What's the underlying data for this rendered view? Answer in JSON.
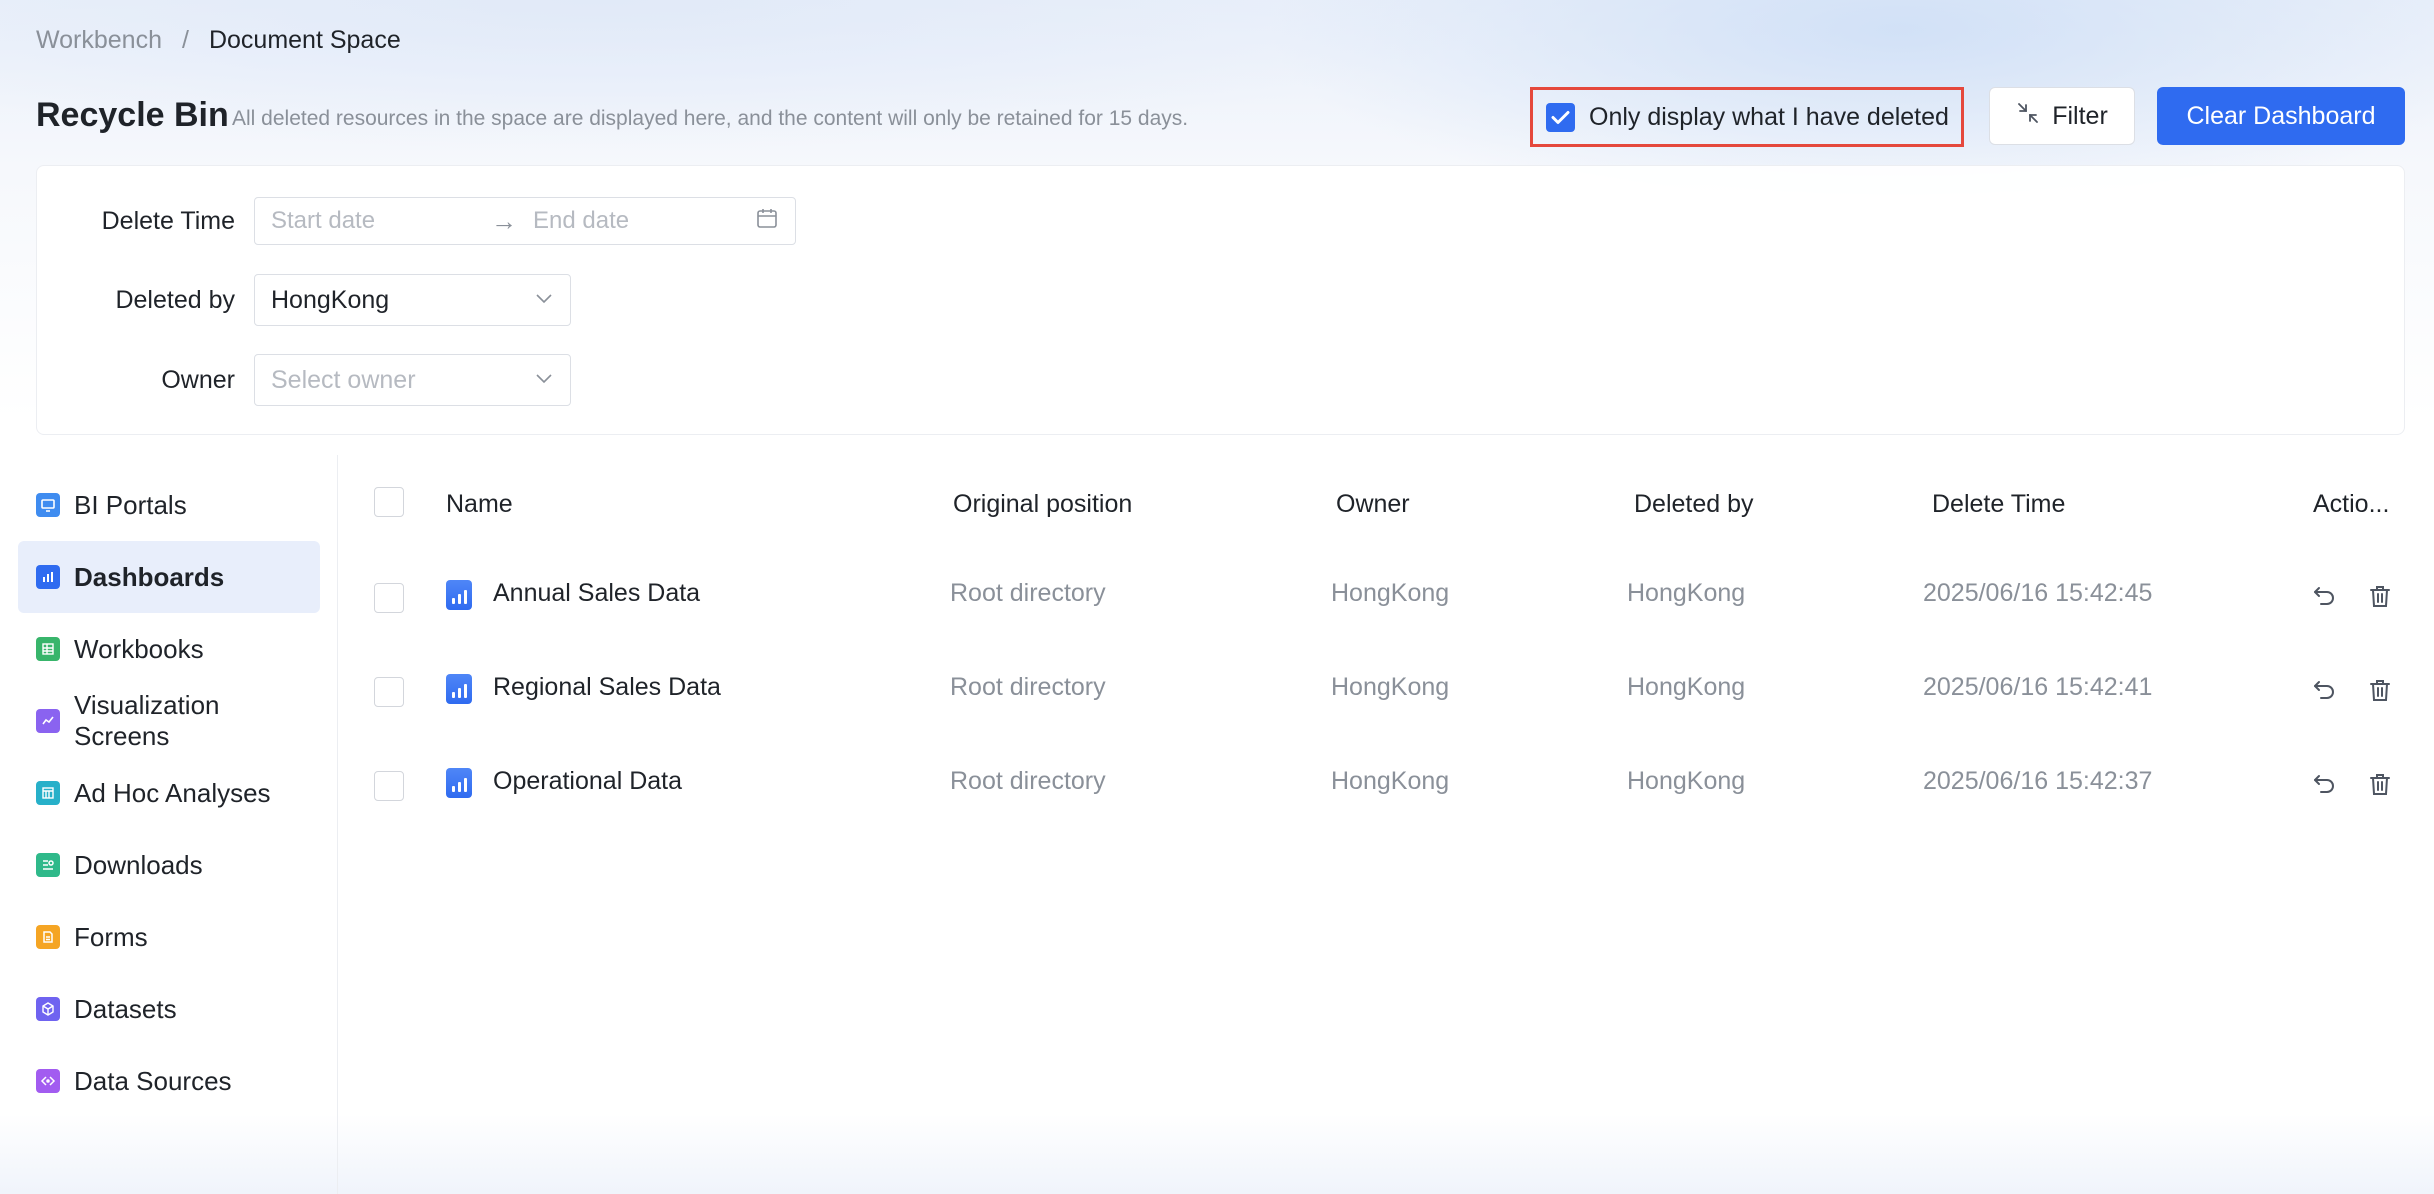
{
  "breadcrumb": {
    "root": "Workbench",
    "separator": "/",
    "current": "Document Space"
  },
  "header": {
    "title": "Recycle Bin",
    "description": "All deleted resources in the space are displayed here, and the content will only be retained for 15 days.",
    "only_mine_label": "Only display what I have deleted",
    "only_mine_checked": true,
    "filter_label": "Filter",
    "clear_label": "Clear Dashboard"
  },
  "filters": {
    "delete_time": {
      "label": "Delete Time",
      "start_placeholder": "Start date",
      "arrow": "→",
      "end_placeholder": "End date"
    },
    "deleted_by": {
      "label": "Deleted by",
      "value": "HongKong"
    },
    "owner": {
      "label": "Owner",
      "placeholder": "Select owner"
    }
  },
  "sidebar": {
    "items": [
      {
        "label": "BI Portals",
        "icon": "monitor-icon",
        "color": "#3f8cf0",
        "active": false
      },
      {
        "label": "Dashboards",
        "icon": "bar-chart-icon",
        "color": "#2f6bf0",
        "active": true
      },
      {
        "label": "Workbooks",
        "icon": "table-icon",
        "color": "#38b56b",
        "active": false
      },
      {
        "label": "Visualization Screens",
        "icon": "line-chart-icon",
        "color": "#8a63f0",
        "active": false
      },
      {
        "label": "Ad Hoc Analyses",
        "icon": "grid-icon",
        "color": "#27b0c9",
        "active": false
      },
      {
        "label": "Downloads",
        "icon": "download-list-icon",
        "color": "#2fb98a",
        "active": false
      },
      {
        "label": "Forms",
        "icon": "form-icon",
        "color": "#f5a524",
        "active": false
      },
      {
        "label": "Datasets",
        "icon": "cube-icon",
        "color": "#6f63f0",
        "active": false
      },
      {
        "label": "Data Sources",
        "icon": "data-source-icon",
        "color": "#a25cf0",
        "active": false
      }
    ]
  },
  "table": {
    "columns": [
      "Name",
      "Original position",
      "Owner",
      "Deleted by",
      "Delete Time",
      "Actio..."
    ],
    "rows": [
      {
        "name": "Annual Sales Data",
        "position": "Root directory",
        "owner": "HongKong",
        "deleted_by": "HongKong",
        "delete_time": "2025/06/16 15:42:45"
      },
      {
        "name": "Regional Sales Data",
        "position": "Root directory",
        "owner": "HongKong",
        "deleted_by": "HongKong",
        "delete_time": "2025/06/16 15:42:41"
      },
      {
        "name": "Operational Data",
        "position": "Root directory",
        "owner": "HongKong",
        "deleted_by": "HongKong",
        "delete_time": "2025/06/16 15:42:37"
      }
    ],
    "row_actions": [
      "restore-icon",
      "trash-icon"
    ]
  },
  "colors": {
    "primary": "#2f6bf0",
    "highlight_border": "#e5483c",
    "muted_text": "#8a9099"
  }
}
